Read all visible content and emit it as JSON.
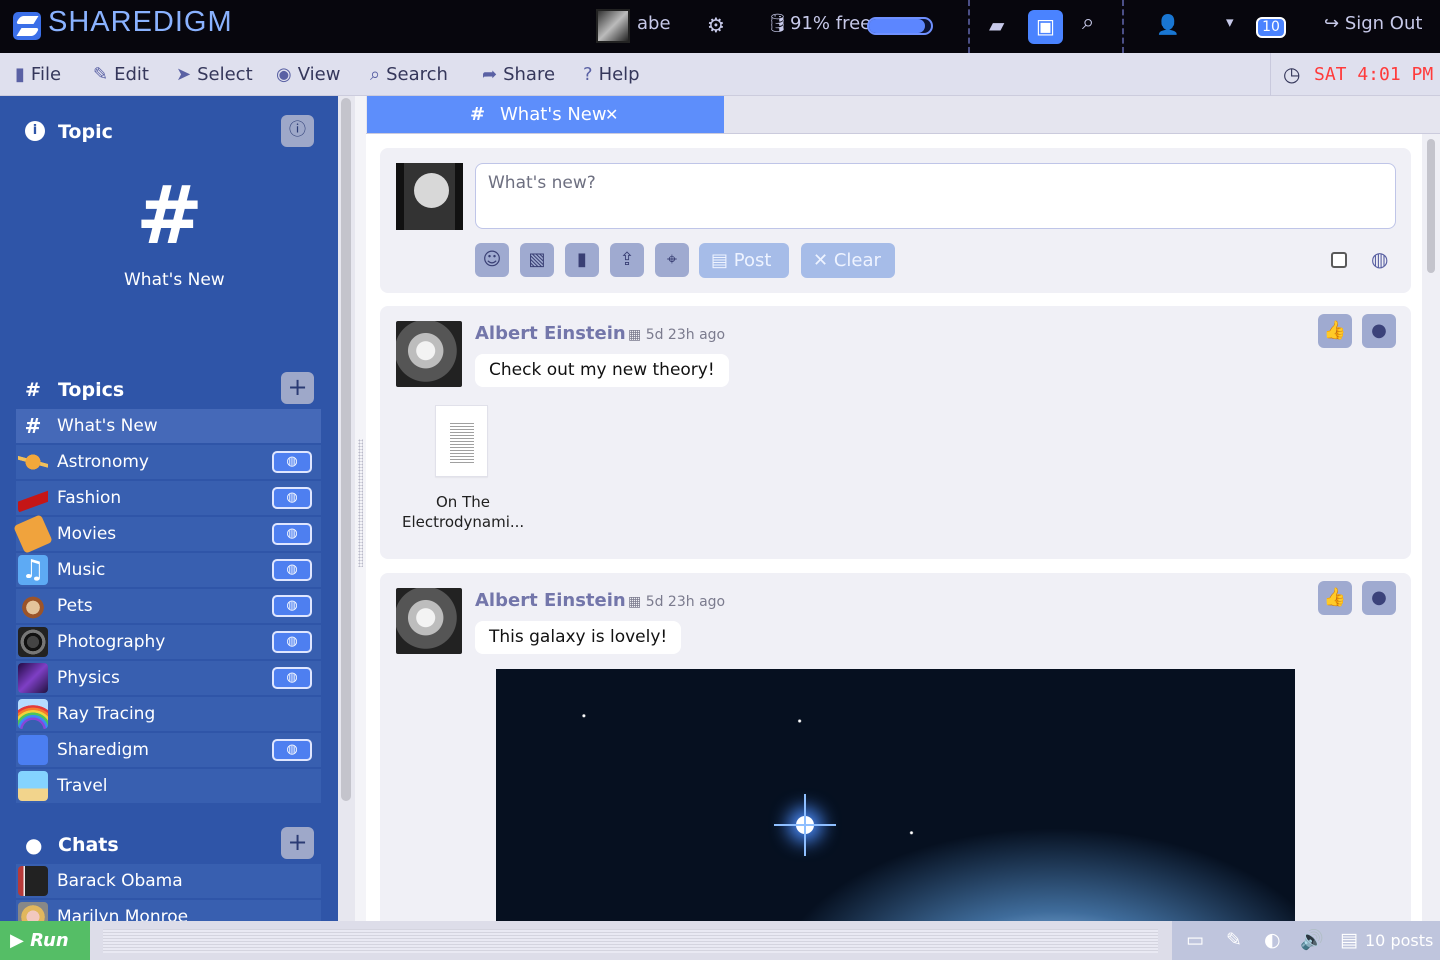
{
  "app": {
    "brand_left": "SHARE",
    "brand_right": "DIGM"
  },
  "topbar": {
    "username": "abe",
    "storage_text": "91% free",
    "storage_percent_free": 91,
    "notifications_count": "10",
    "sign_out_label": "Sign Out"
  },
  "menu": {
    "items": [
      {
        "label": "File",
        "icon": "file-icon"
      },
      {
        "label": "Edit",
        "icon": "pencil-icon"
      },
      {
        "label": "Select",
        "icon": "cursor-icon"
      },
      {
        "label": "View",
        "icon": "eye-icon"
      },
      {
        "label": "Search",
        "icon": "search-icon"
      },
      {
        "label": "Share",
        "icon": "share-icon"
      },
      {
        "label": "Help",
        "icon": "help-icon"
      }
    ],
    "clock": "SAT 4:01 PM"
  },
  "sidebar": {
    "topic_title": "Topic",
    "current_topic": "What's New",
    "topics_title": "Topics",
    "topics": [
      {
        "label": "What's New",
        "icon": "hash-icon",
        "shared": false
      },
      {
        "label": "Astronomy",
        "icon": "planet-icon",
        "shared": true
      },
      {
        "label": "Fashion",
        "icon": "shoe-icon",
        "shared": true
      },
      {
        "label": "Movies",
        "icon": "ticket-icon",
        "shared": true
      },
      {
        "label": "Music",
        "icon": "music-note-icon",
        "shared": true
      },
      {
        "label": "Pets",
        "icon": "dog-icon",
        "shared": true
      },
      {
        "label": "Photography",
        "icon": "camera-icon",
        "shared": true
      },
      {
        "label": "Physics",
        "icon": "galaxy-icon",
        "shared": true
      },
      {
        "label": "Ray Tracing",
        "icon": "rainbow-icon",
        "shared": false
      },
      {
        "label": "Sharedigm",
        "icon": "sharedigm-icon",
        "shared": true
      },
      {
        "label": "Travel",
        "icon": "beach-umbrella-icon",
        "shared": false
      }
    ],
    "chats_title": "Chats",
    "chats": [
      {
        "label": "Barack Obama",
        "icon": "avatar-obama"
      },
      {
        "label": "Marilyn Monroe",
        "icon": "avatar-monroe"
      }
    ]
  },
  "tab": {
    "label": "What's New"
  },
  "composer": {
    "placeholder": "What's new?",
    "post_label": "Post",
    "clear_label": "Clear"
  },
  "posts": [
    {
      "author": "Albert Einstein",
      "time": "5d 23h ago",
      "message": "Check out my new theory!",
      "attachment": "On The Electrodynami..."
    },
    {
      "author": "Albert Einstein",
      "time": "5d 23h ago",
      "message": "This galaxy is lovely!"
    }
  ],
  "status": {
    "run_label": "Run",
    "posts_count": "10 posts"
  }
}
